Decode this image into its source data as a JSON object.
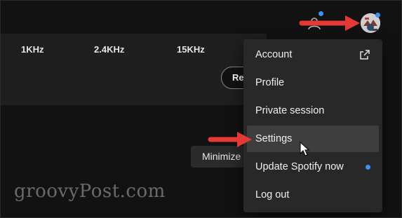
{
  "equalizer": {
    "frequencies": [
      "1KHz",
      "2.4KHz",
      "15KHz"
    ],
    "reset_label": "Reset"
  },
  "minimize_label": "Minimize",
  "menu": {
    "items": [
      {
        "label": "Account"
      },
      {
        "label": "Profile"
      },
      {
        "label": "Private session"
      },
      {
        "label": "Settings"
      },
      {
        "label": "Update Spotify now"
      },
      {
        "label": "Log out"
      }
    ]
  },
  "watermark": "groovyPost.com",
  "colors": {
    "background": "#121212",
    "menu_bg": "#282828",
    "hover_bg": "#3e3e3e",
    "notification_dot": "#3d91f4",
    "annotation_arrow": "#e53935"
  }
}
